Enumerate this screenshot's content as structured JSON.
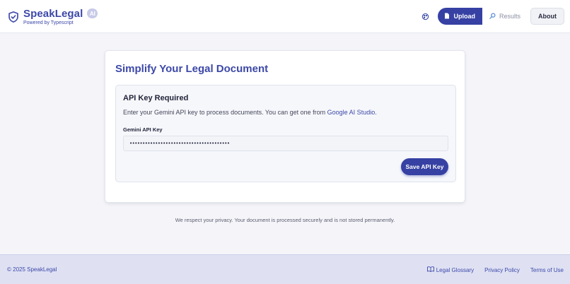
{
  "header": {
    "brand_name": "SpeakLegal",
    "brand_badge": "AI",
    "brand_sub": "Powered by Typescript",
    "nav": {
      "upload": "Upload",
      "results": "Results",
      "about": "About"
    }
  },
  "main": {
    "title": "Simplify Your Legal Document",
    "api_panel": {
      "title": "API Key Required",
      "description": "Enter your Gemini API key to process documents. You can get one from ",
      "link_text": "Google AI Studio",
      "description_end": ".",
      "field_label": "Gemini API Key",
      "field_value": "•••••••••••••••••••••••••••••••••••••••",
      "save_label": "Save API Key"
    },
    "privacy_note": "We respect your privacy. Your document is processed securely and is not stored permanently."
  },
  "footer": {
    "copyright": "© 2025 SpeakLegal",
    "links": [
      "Legal Glossary",
      "Privacy Policy",
      "Terms of Use"
    ]
  },
  "colors": {
    "accent": "#3641a3",
    "brand_text": "#3c48a8",
    "background": "#f5f5f9",
    "footer_bg": "#dfe1f3"
  },
  "icons": {
    "logo": "shield-check-icon",
    "theme": "palette-icon",
    "upload": "document-icon",
    "results": "magnifier-icon",
    "glossary": "book-icon"
  }
}
